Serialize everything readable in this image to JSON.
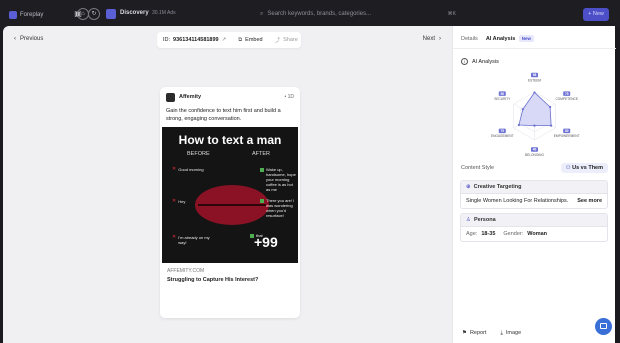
{
  "topbar": {
    "brand": "Foreplay",
    "breadcrumb_title": "Discovery",
    "breadcrumb_sub": "30.1M Ads",
    "search_placeholder": "Search keywords, brands, categories...",
    "search_shortcut": "⌘K",
    "new_label": "+ New"
  },
  "nav": {
    "previous": "Previous",
    "next": "Next",
    "id_label": "ID:",
    "id_value": "936134114581899",
    "embed": "Embed",
    "share": "Share"
  },
  "ad": {
    "brand": "Affemity",
    "time": "• 1D",
    "copy": "Gain the confidence to text him first and build a strong, engaging conversation.",
    "image": {
      "title": "How to text a man",
      "before": "BEFORE",
      "after": "AFTER",
      "before_items": [
        "Good morning",
        "Hey",
        "I'm already on my way!"
      ],
      "after_items": [
        "Wake up, handsome, hope your morning coffee is as hot as me",
        "There you are! I was wondering when you'd resurface!",
        "that"
      ],
      "more": "+99"
    },
    "domain": "AFFEMITY.COM",
    "headline": "Struggling to Capture His Interest?"
  },
  "panel": {
    "tab_details": "Details",
    "tab_ai": "AI Analysis",
    "new_badge": "New",
    "ai_title": "AI Analysis",
    "radar": {
      "axes": [
        {
          "label": "ESTEEM",
          "value": 98
        },
        {
          "label": "COMPETENCE",
          "value": 75
        },
        {
          "label": "EMPOWERMENT",
          "value": 80
        },
        {
          "label": "BELONGING",
          "value": 40
        },
        {
          "label": "ENGAGEMENT",
          "value": 75
        },
        {
          "label": "SECURITY",
          "value": 56
        }
      ],
      "max": 100
    },
    "content_style_label": "Content Style",
    "content_style_value": "Us vs Them",
    "creative_targeting_title": "Creative Targeting",
    "creative_targeting_value": "Single Women Looking For Relationships.",
    "see_more": "See more",
    "persona_title": "Persona",
    "age_label": "Age:",
    "age_value": "18-35",
    "gender_label": "Gender:",
    "gender_value": "Woman",
    "report": "Report",
    "image": "Image"
  },
  "colors": {
    "accent": "#4c4fc8",
    "radar_fill": "#d8d9f6",
    "radar_stroke": "#6a6fd0",
    "badge_bg": "#6d72d4"
  }
}
